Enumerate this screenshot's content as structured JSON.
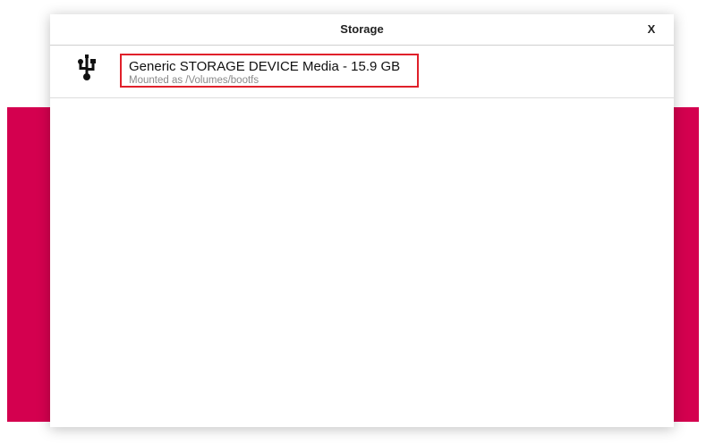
{
  "dialog": {
    "title": "Storage",
    "close_label": "X"
  },
  "devices": [
    {
      "name": "Generic STORAGE DEVICE Media - 15.9 GB",
      "mount": "Mounted as /Volumes/bootfs",
      "icon": "usb-icon"
    }
  ],
  "colors": {
    "accent": "#d4004f",
    "highlight": "#e0202a"
  }
}
